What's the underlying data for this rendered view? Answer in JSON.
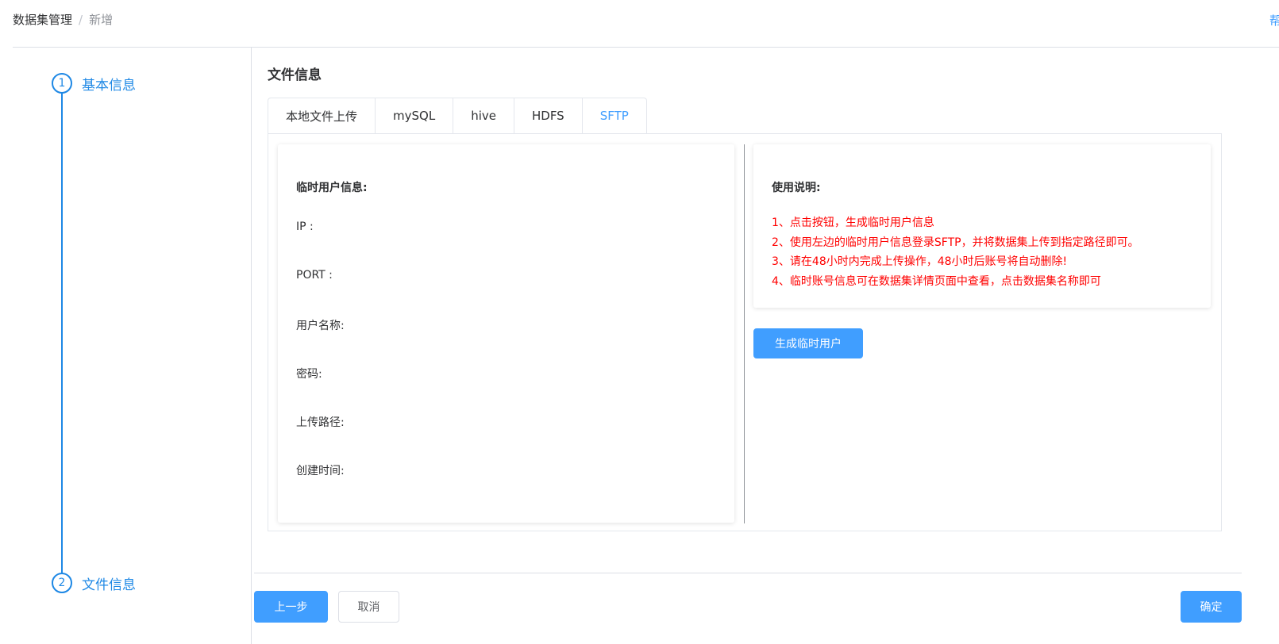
{
  "breadcrumb": {
    "parent": "数据集管理",
    "separator": "/",
    "current": "新增"
  },
  "help_link": "帮助",
  "steps": [
    {
      "number": "1",
      "label": "基本信息"
    },
    {
      "number": "2",
      "label": "文件信息"
    }
  ],
  "section_title": "文件信息",
  "tabs": [
    {
      "label": "本地文件上传",
      "active": false
    },
    {
      "label": "mySQL",
      "active": false
    },
    {
      "label": "hive",
      "active": false
    },
    {
      "label": "HDFS",
      "active": false
    },
    {
      "label": "SFTP",
      "active": true
    }
  ],
  "user_info": {
    "title": "临时用户信息:",
    "fields": [
      {
        "label": "IP :",
        "value": ""
      },
      {
        "label": "PORT :",
        "value": ""
      },
      {
        "label": "用户名称:",
        "value": ""
      },
      {
        "label": "密码:",
        "value": ""
      },
      {
        "label": "上传路径:",
        "value": ""
      },
      {
        "label": "创建时间:",
        "value": ""
      }
    ]
  },
  "instructions": {
    "title": "使用说明:",
    "items": [
      "1、点击按钮，生成临时用户信息",
      "2、使用左边的临时用户信息登录SFTP，并将数据集上传到指定路径即可。",
      "3、请在48小时内完成上传操作，48小时后账号将自动删除!",
      "4、临时账号信息可在数据集详情页面中查看，点击数据集名称即可"
    ],
    "color": "#ff0000"
  },
  "buttons": {
    "generate": "生成临时用户",
    "prev": "上一步",
    "cancel": "取消",
    "confirm": "确定"
  },
  "colors": {
    "primary": "#409eff",
    "step": "#1e88e5"
  }
}
